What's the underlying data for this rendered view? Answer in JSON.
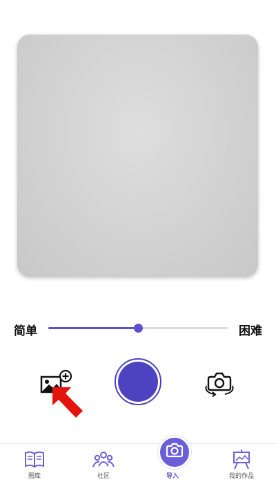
{
  "difficulty": {
    "easy_label": "简单",
    "hard_label": "困难",
    "level_fraction": 0.5
  },
  "icons": {
    "import": "image-add-icon",
    "capture": "shutter-icon",
    "switch_camera": "camera-switch-icon",
    "pointer": "red-arrow-icon"
  },
  "colors": {
    "accent": "#5b4fd1",
    "capture": "#4d43c0",
    "pointer": "#e3120b"
  },
  "tabbar": {
    "items": [
      {
        "label": "图库",
        "icon": "book-icon"
      },
      {
        "label": "社区",
        "icon": "people-icon"
      },
      {
        "label": "导入",
        "icon": "camera-icon"
      },
      {
        "label": "我的作品",
        "icon": "easel-icon"
      }
    ]
  }
}
